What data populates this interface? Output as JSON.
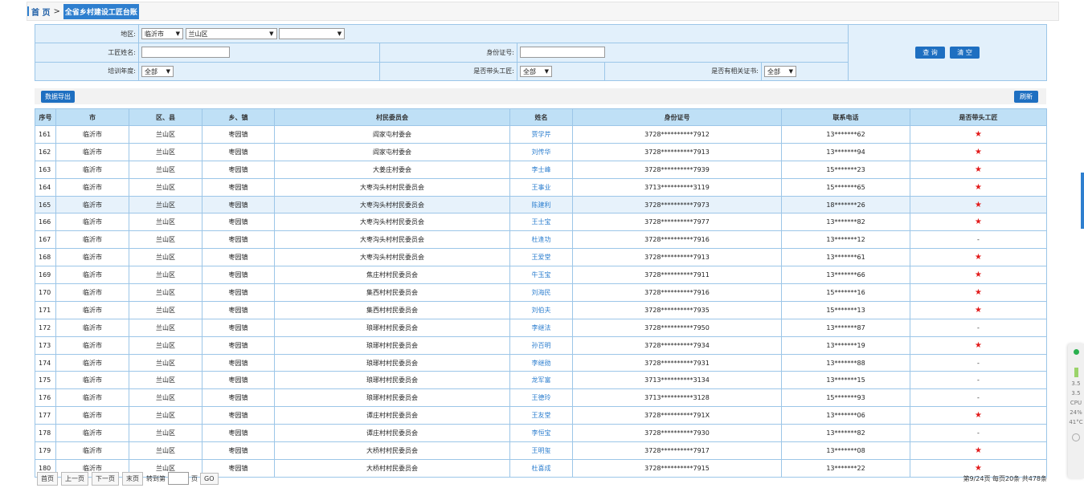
{
  "breadcrumb": {
    "home": "首 页",
    "sep": ">",
    "current": "全省乡村建设工匠台账"
  },
  "filters": {
    "region_label": "地区:",
    "city": "临沂市",
    "district": "兰山区",
    "town": "",
    "name_label": "工匠姓名:",
    "name_value": "",
    "id_label": "身份证号:",
    "id_value": "",
    "year_label": "培训年度:",
    "year_value": "全部",
    "leader_label": "是否带头工匠:",
    "leader_value": "全部",
    "cert_label": "是否有相关证书:",
    "cert_value": "全部",
    "query_btn": "查 询",
    "clear_btn": "清 空"
  },
  "toolbar": {
    "export": "数据导出",
    "refresh": "刷新"
  },
  "table": {
    "headers": [
      "序号",
      "市",
      "区、县",
      "乡、镇",
      "村民委员会",
      "姓名",
      "身份证号",
      "联系电话",
      "是否带头工匠"
    ],
    "rows": [
      {
        "no": "161",
        "city": "临沂市",
        "county": "兰山区",
        "town": "枣园镇",
        "village": "阎家屯村委会",
        "name": "贾学芹",
        "id": "3728**********7912",
        "phone": "13*******62",
        "leader": "★"
      },
      {
        "no": "162",
        "city": "临沂市",
        "county": "兰山区",
        "town": "枣园镇",
        "village": "阎家屯村委会",
        "name": "刘传华",
        "id": "3728**********7913",
        "phone": "13*******94",
        "leader": "★"
      },
      {
        "no": "163",
        "city": "临沂市",
        "county": "兰山区",
        "town": "枣园镇",
        "village": "大姜庄村委会",
        "name": "李士峰",
        "id": "3728**********7939",
        "phone": "15*******23",
        "leader": "★"
      },
      {
        "no": "164",
        "city": "临沂市",
        "county": "兰山区",
        "town": "枣园镇",
        "village": "大枣沟头村村民委员会",
        "name": "王事业",
        "id": "3713**********3119",
        "phone": "15*******65",
        "leader": "★"
      },
      {
        "no": "165",
        "city": "临沂市",
        "county": "兰山区",
        "town": "枣园镇",
        "village": "大枣沟头村村民委员会",
        "name": "陈建利",
        "id": "3728**********7973",
        "phone": "18*******26",
        "leader": "★"
      },
      {
        "no": "166",
        "city": "临沂市",
        "county": "兰山区",
        "town": "枣园镇",
        "village": "大枣沟头村村民委员会",
        "name": "王士宝",
        "id": "3728**********7977",
        "phone": "13*******82",
        "leader": "★"
      },
      {
        "no": "167",
        "city": "临沂市",
        "county": "兰山区",
        "town": "枣园镇",
        "village": "大枣沟头村村民委员会",
        "name": "杜逢功",
        "id": "3728**********7916",
        "phone": "13*******12",
        "leader": "-"
      },
      {
        "no": "168",
        "city": "临沂市",
        "county": "兰山区",
        "town": "枣园镇",
        "village": "大枣沟头村村民委员会",
        "name": "王爱堂",
        "id": "3728**********7913",
        "phone": "13*******61",
        "leader": "★"
      },
      {
        "no": "169",
        "city": "临沂市",
        "county": "兰山区",
        "town": "枣园镇",
        "village": "焦庄村村民委员会",
        "name": "牛玉宝",
        "id": "3728**********7911",
        "phone": "13*******66",
        "leader": "★"
      },
      {
        "no": "170",
        "city": "临沂市",
        "county": "兰山区",
        "town": "枣园镇",
        "village": "集西村村民委员会",
        "name": "刘海民",
        "id": "3728**********7916",
        "phone": "15*******16",
        "leader": "★"
      },
      {
        "no": "171",
        "city": "临沂市",
        "county": "兰山区",
        "town": "枣园镇",
        "village": "集西村村民委员会",
        "name": "刘伯夫",
        "id": "3728**********7935",
        "phone": "15*******13",
        "leader": "★"
      },
      {
        "no": "172",
        "city": "临沂市",
        "county": "兰山区",
        "town": "枣园镇",
        "village": "琅琊村村民委员会",
        "name": "李继法",
        "id": "3728**********7950",
        "phone": "13*******87",
        "leader": "-"
      },
      {
        "no": "173",
        "city": "临沂市",
        "county": "兰山区",
        "town": "枣园镇",
        "village": "琅琊村村民委员会",
        "name": "孙百明",
        "id": "3728**********7934",
        "phone": "13*******19",
        "leader": "★"
      },
      {
        "no": "174",
        "city": "临沂市",
        "county": "兰山区",
        "town": "枣园镇",
        "village": "琅琊村村民委员会",
        "name": "李继勋",
        "id": "3728**********7931",
        "phone": "13*******88",
        "leader": "-"
      },
      {
        "no": "175",
        "city": "临沂市",
        "county": "兰山区",
        "town": "枣园镇",
        "village": "琅琊村村民委员会",
        "name": "龙军富",
        "id": "3713**********3134",
        "phone": "13*******15",
        "leader": "-"
      },
      {
        "no": "176",
        "city": "临沂市",
        "county": "兰山区",
        "town": "枣园镇",
        "village": "琅琊村村民委员会",
        "name": "王德玲",
        "id": "3713**********3128",
        "phone": "15*******93",
        "leader": "-"
      },
      {
        "no": "177",
        "city": "临沂市",
        "county": "兰山区",
        "town": "枣园镇",
        "village": "谭庄村村民委员会",
        "name": "王友堂",
        "id": "3728**********791X",
        "phone": "13*******06",
        "leader": "★"
      },
      {
        "no": "178",
        "city": "临沂市",
        "county": "兰山区",
        "town": "枣园镇",
        "village": "谭庄村村民委员会",
        "name": "李恒宝",
        "id": "3728**********7930",
        "phone": "13*******82",
        "leader": "-"
      },
      {
        "no": "179",
        "city": "临沂市",
        "county": "兰山区",
        "town": "枣园镇",
        "village": "大桥村村民委员会",
        "name": "王明玺",
        "id": "3728**********7917",
        "phone": "13*******08",
        "leader": "★"
      },
      {
        "no": "180",
        "city": "临沂市",
        "county": "兰山区",
        "town": "枣园镇",
        "village": "大桥村村民委员会",
        "name": "杜喜成",
        "id": "3728**********7915",
        "phone": "13*******22",
        "leader": "★"
      }
    ],
    "highlight_row": "165"
  },
  "pager": {
    "first": "首页",
    "prev": "上一页",
    "next": "下一页",
    "last": "末页",
    "goto_label": "转到第",
    "page_unit": "页",
    "go": "GO",
    "info": "第9/24页 每页20条 共478条"
  },
  "widget": {
    "v1": "3.5",
    "v2": "3.5",
    "cpu": "CPU",
    "pct": "24%",
    "temp": "41°C"
  },
  "colors": {
    "accent": "#1e6fc1",
    "header_bg": "#bfe0f6",
    "filter_bg": "#e2f0fb",
    "star": "#e21b1b"
  }
}
